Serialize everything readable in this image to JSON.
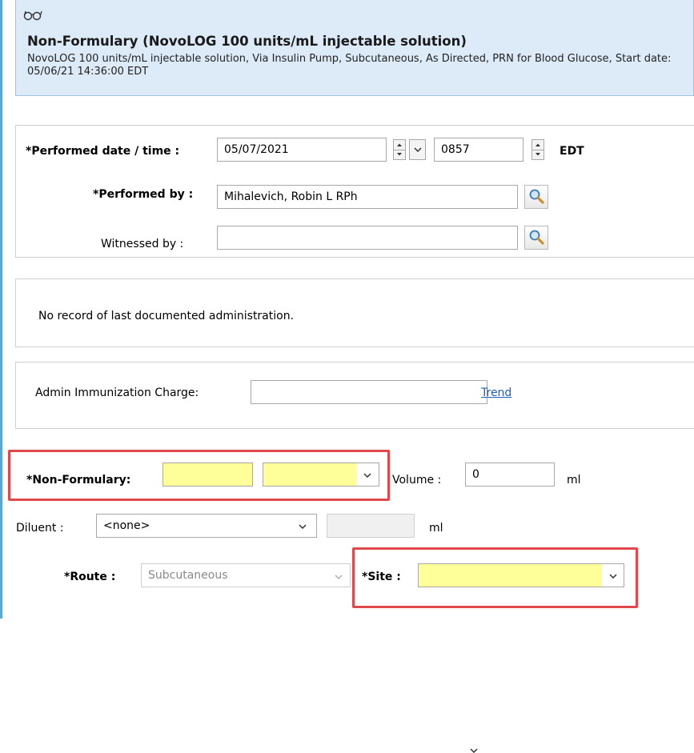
{
  "header": {
    "title": "Non-Formulary (NovoLOG 100 units/mL injectable solution)",
    "description": "NovoLOG 100 units/mL injectable solution, Via Insulin Pump, Subcutaneous, As Directed, PRN for Blood Glucose, Start date: 05/06/21 14:36:00 EDT"
  },
  "performed": {
    "date_label": "*Performed date / time :",
    "date_value": "05/07/2021",
    "time_value": "0857",
    "timezone": "EDT",
    "by_label": "*Performed by :",
    "by_value": "Mihalevich, Robin L RPh",
    "witness_label": "Witnessed by :",
    "witness_value": ""
  },
  "last_admin": {
    "message": "No record of last documented administration."
  },
  "charge": {
    "label": "Admin Immunization Charge:",
    "value": "",
    "trend_link": "Trend"
  },
  "dose": {
    "nonformulary_label": "*Non-Formulary:",
    "nonformulary_value": "",
    "unit_value": "",
    "volume_label": "Volume :",
    "volume_value": "0",
    "volume_unit": "ml",
    "diluent_label": "Diluent :",
    "diluent_value": "<none>",
    "diluent_amount": "",
    "diluent_unit": "ml",
    "route_label": "*Route :",
    "route_value": "Subcutaneous",
    "site_label": "*Site :",
    "site_value": ""
  },
  "colors": {
    "required_highlight": "#ffff99",
    "callout_border": "#e0484b",
    "header_bg": "#dcebf7",
    "link": "#1f5fbf"
  },
  "icons": [
    "glasses-icon",
    "search-icon",
    "spin-up-icon",
    "spin-down-icon",
    "chevron-down-icon"
  ]
}
